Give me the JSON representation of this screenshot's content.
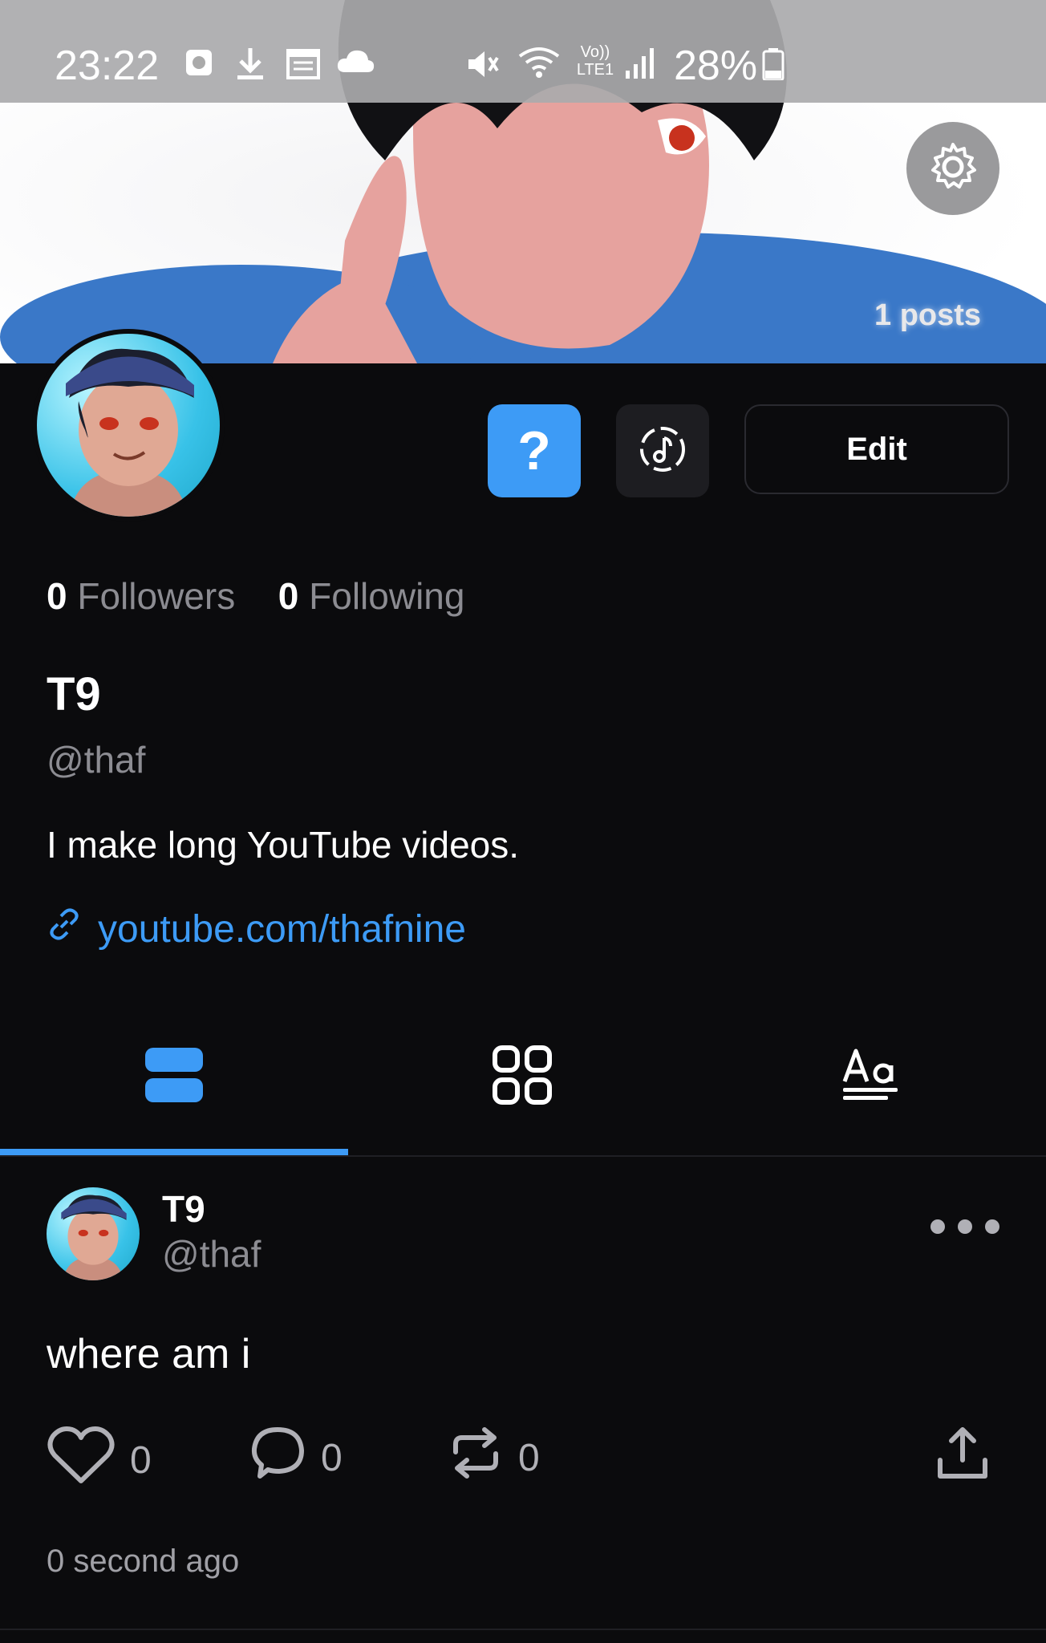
{
  "status_bar": {
    "time": "23:22",
    "network_label": "Vo)) LTE1",
    "battery": "28%"
  },
  "banner": {
    "posts_count": "1 posts"
  },
  "profile": {
    "followers_count": "0",
    "followers_label": "Followers",
    "following_count": "0",
    "following_label": "Following",
    "display_name": "T9",
    "handle": "@thaf",
    "bio": "I make long YouTube videos.",
    "link": "youtube.com/thafnine",
    "edit_label": "Edit",
    "help_label": "?"
  },
  "tabs": [
    {
      "name": "posts-list",
      "icon": "list-icon",
      "active": true
    },
    {
      "name": "grid",
      "icon": "grid-icon",
      "active": false
    },
    {
      "name": "text",
      "icon": "text-icon",
      "active": false
    }
  ],
  "post": {
    "author_name": "T9",
    "author_handle": "@thaf",
    "text": "where am i",
    "likes": "0",
    "comments": "0",
    "reposts": "0",
    "time": "0 second ago"
  },
  "colors": {
    "accent": "#3d9bf6",
    "background": "#0b0b0d",
    "muted_text": "#8c8c92"
  }
}
